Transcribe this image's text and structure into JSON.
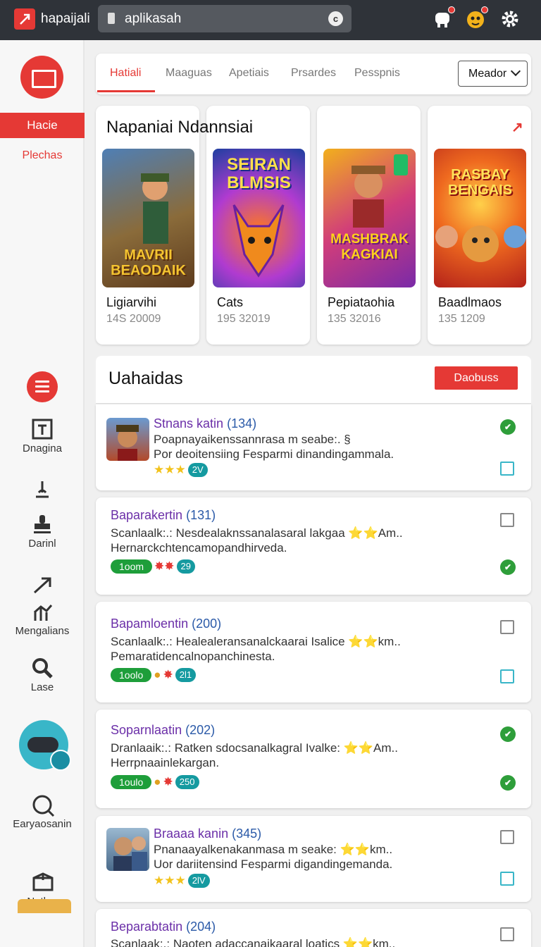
{
  "topbar": {
    "app_name": "hapaijali",
    "search_value": "aplikasah",
    "icons": [
      "app-logo-icon",
      "search-icon",
      "clear-icon",
      "notification-icon",
      "avatar-icon",
      "gear-icon"
    ]
  },
  "sidebar": {
    "active_tab": "Hacie",
    "tab2": "Plechas",
    "items": [
      {
        "label": "Dnagina",
        "icon": "calendar-icon"
      },
      {
        "label": "Darinl",
        "icon": "stamp-icon"
      },
      {
        "label": "Mengalians",
        "icon": "chart-icon"
      },
      {
        "label": "Lase",
        "icon": "search-icon"
      },
      {
        "label": "Earyaosanin",
        "icon": "magnifier-icon"
      },
      {
        "label": "Natloa",
        "icon": "box-icon"
      }
    ]
  },
  "tabs": {
    "items": [
      "Hatiali",
      "Maaguas",
      "Apetiais",
      "Prsardes",
      "Pesspnis"
    ],
    "dropdown": "Meador"
  },
  "featured": {
    "title": "Napaniai Ndannsiai",
    "games": [
      {
        "cover": "MAVRII BEAODAIK",
        "name": "Ligiarvihi",
        "num": "14S 20009",
        "color": "#7a6a40"
      },
      {
        "cover": "SEIRAN BLMSIS",
        "name": "Cats",
        "num": "195 32019",
        "color": "#3557c5"
      },
      {
        "cover": "MASHBRAK KAGKIAI",
        "name": "Pepiataohia",
        "num": "135 32016",
        "color": "#b0368f"
      },
      {
        "cover": "RASBAY BENGAIS",
        "name": "Baadlmaos",
        "num": "135 1209",
        "color": "#d9541f"
      }
    ]
  },
  "list": {
    "title": "Uahaidas",
    "button": "Daobuss",
    "rows": [
      {
        "title": "Stnans katin",
        "count": "(134)",
        "line1": "Poapnayaikenssannrasa m seabe:. §",
        "line2": "Por deoitensiing Fesparmi dinandingammala.",
        "chip_green": "",
        "chip_teal": "2V"
      },
      {
        "title": "Baparakertin",
        "count": "(131)",
        "line1": "Scanlaalk:.: Nesdealaknssanalasaral lakgaa ⭐⭐Am..",
        "line2": "Hernarckchtencamopandhirveda.",
        "chip_green": "1oom",
        "chip_teal": "29"
      },
      {
        "title": "Bapamloentin",
        "count": "(200)",
        "line1": "Scanlaalk:.: Healealeransanalckaarai Isalice ⭐⭐km..",
        "line2": "Pemaratidencalnopanchinesta.",
        "chip_green": "1oolo",
        "chip_teal": "2l1"
      },
      {
        "title": "Soparnlaatin",
        "count": "(202)",
        "line1": "Dranlaaik:.: Ratken sdocsanalkagral Ivalke: ⭐⭐Am..",
        "line2": "Herrpnaainlekargan.",
        "chip_green": "1oulo",
        "chip_teal": "250"
      },
      {
        "title": "Braaaa kanin",
        "count": "(345)",
        "line1": "Pnanaayalkenakanmasa m seake: ⭐⭐km..",
        "line2": "Uor dariitensind Fesparmi digandingemanda.",
        "chip_green": "",
        "chip_teal": "2lV"
      },
      {
        "title": "Beparabtatin",
        "count": "(204)",
        "line1": "Scanlaak:.: Naoten adaccanaikaaral loatics ⭐⭐km..",
        "line2": "",
        "chip_green": "",
        "chip_teal": ""
      }
    ]
  }
}
